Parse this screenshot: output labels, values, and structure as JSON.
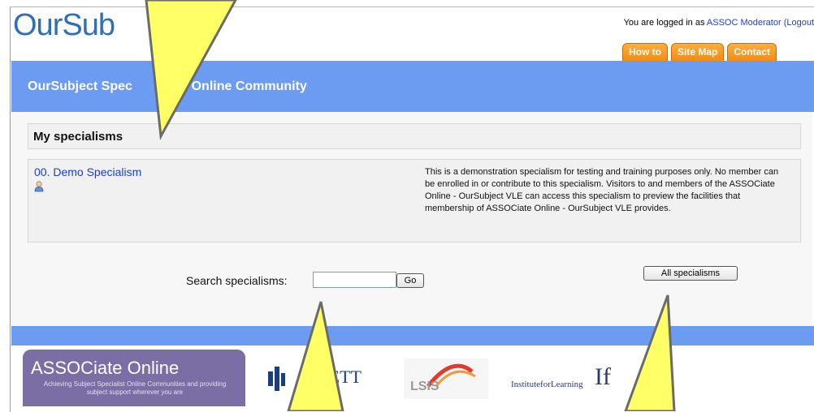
{
  "header": {
    "logo": "OurSub",
    "login_prefix": "You are logged in as ",
    "login_user": "ASSOC Moderator",
    "logout_label": "(Logout",
    "tabs": [
      "How to",
      "Site Map",
      "Contact"
    ],
    "title": "OurSubject Spec",
    "title_tail": "ct Online Community"
  },
  "main": {
    "section_title": "My specialisms",
    "specialism": {
      "name": "00. Demo Specialism",
      "description": "This is a demonstration specialism for testing and training purposes only. No member can be enrolled in or contribute to this specialism. Visitors to and members of the ASSOCiate Online - OurSubject VLE can access this specialism to preview the facilities that membership of ASSOCiate Online - OurSubject VLE provides."
    },
    "search_label": "Search specialisms:",
    "search_value": "",
    "go_label": "Go",
    "all_label": "All specialisms"
  },
  "footer": {
    "assoc_title": "ASSOCiate Online",
    "assoc_tagline": "Achieving Subject Specialist Online Communities and providing subject support wherever you are",
    "cett_label": "CETT",
    "lsis_label": "LSIS",
    "ifl_label": "InstituteforLearning",
    "ifl_glyph": "If"
  },
  "colors": {
    "header_band": "#6c9bf2",
    "tab_orange": "#f08a12",
    "link_blue": "#1a3fd3",
    "callout_yellow": "#ffff66"
  }
}
